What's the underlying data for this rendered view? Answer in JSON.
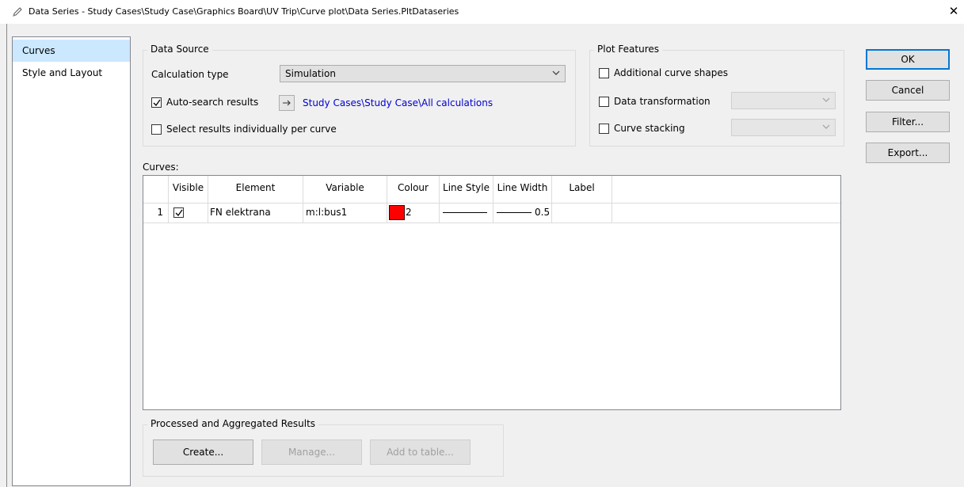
{
  "window": {
    "title": "Data Series - Study Cases\\Study Case\\Graphics Board\\UV Trip\\Curve plot\\Data Series.PltDataseries",
    "close_symbol": "✕"
  },
  "nav": {
    "items": [
      {
        "label": "Curves",
        "selected": true
      },
      {
        "label": "Style and Layout",
        "selected": false
      }
    ]
  },
  "data_source": {
    "group_label": "Data Source",
    "calc_type_label": "Calculation type",
    "calc_type_value": "Simulation",
    "auto_search_label": "Auto-search results",
    "auto_search_checked": true,
    "arrow_icon": "right-arrow-icon",
    "results_link": "Study Cases\\Study Case\\All calculations",
    "select_individual_label": "Select results individually per curve",
    "select_individual_checked": false
  },
  "plot_features": {
    "group_label": "Plot Features",
    "additional_shapes_label": "Additional curve shapes",
    "data_transformation_label": "Data transformation",
    "curve_stacking_label": "Curve stacking"
  },
  "curves": {
    "label": "Curves:",
    "columns": [
      "",
      "Visible",
      "Element",
      "Variable",
      "Colour",
      "Line Style",
      "Line Width",
      "Label"
    ],
    "rows": [
      {
        "index": "1",
        "visible": true,
        "element": "FN elektrana",
        "variable": "m:l:bus1",
        "colour_hex": "#ff0000",
        "colour_index": "2",
        "line_style": "solid",
        "line_width": "0.5",
        "label": ""
      }
    ]
  },
  "processed": {
    "group_label": "Processed and Aggregated Results",
    "create": "Create...",
    "manage": "Manage...",
    "add_to_table": "Add to table..."
  },
  "buttons": {
    "ok": "OK",
    "cancel": "Cancel",
    "filter": "Filter...",
    "export": "Export..."
  },
  "colors": {
    "accent": "#0078d7",
    "selection": "#cce8ff",
    "link": "#0000d0"
  }
}
